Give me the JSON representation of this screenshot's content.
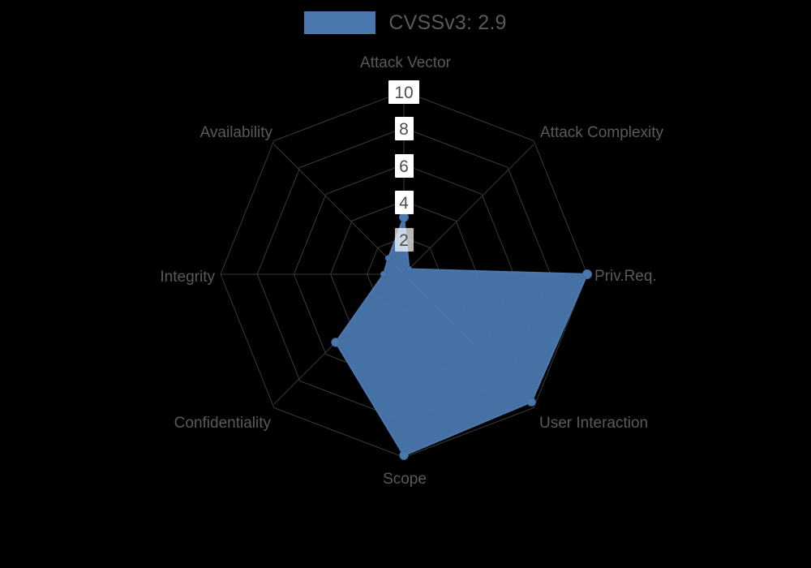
{
  "legend": {
    "label": "CVSSv3: 2.9",
    "swatch_color": "#4a77ad",
    "swatch_name": "legend-color-swatch"
  },
  "colors": {
    "background": "#000000",
    "series_fill": "#4a77ad",
    "series_stroke": "#4a77ad",
    "grid": "#3a3a3a",
    "label_text": "#5a5a5a",
    "tick_text": "#4d4d4d",
    "tick_background": "#ffffff"
  },
  "axis_labels": {
    "attack_vector": "Attack Vector",
    "attack_complexity": "Attack Complexity",
    "priv_req": "Priv.Req.",
    "user_interaction": "User Interaction",
    "scope": "Scope",
    "confidentiality": "Confidentiality",
    "integrity": "Integrity",
    "availability": "Availability"
  },
  "ticks": {
    "t10": "10",
    "t8": "8",
    "t6": "6",
    "t4": "4",
    "t2": "2"
  },
  "chart_data": {
    "type": "radar",
    "title": "CVSSv3: 2.9",
    "subtitle": "",
    "xlabel": "",
    "ylabel": "",
    "categories": [
      "Attack Vector",
      "Attack Complexity",
      "Priv.Req.",
      "User Interaction",
      "Scope",
      "Confidentiality",
      "Integrity",
      "Availability"
    ],
    "series": [
      {
        "name": "CVSSv3: 2.9",
        "color": "#4a77ad",
        "values": [
          3.1,
          0.4,
          10.0,
          9.8,
          9.9,
          5.2,
          1.1,
          1.2
        ]
      }
    ],
    "tick_values": [
      2,
      4,
      6,
      8,
      10
    ],
    "rlim": [
      0,
      10
    ],
    "grid": true,
    "legend_position": "top-center",
    "angle_start_deg": 90,
    "angle_direction": "clockwise",
    "markers": true
  }
}
